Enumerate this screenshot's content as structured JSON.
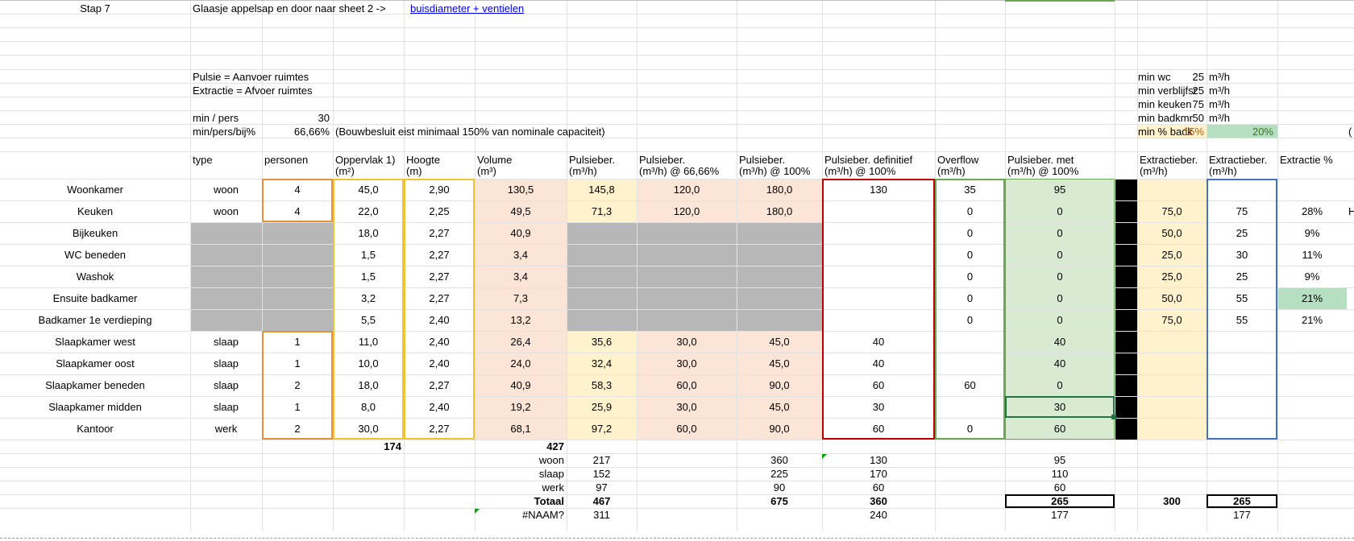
{
  "colors": {
    "grid": "#e2e2e2",
    "peach": "#fce4d6",
    "cream": "#fff2cc",
    "green": "#d9ead3",
    "gray": "#b7b7b7",
    "orange_border": "#f4b183",
    "orange_border_dark": "#e69138",
    "yellow_border": "#f1c232",
    "red_border": "#c00000",
    "green_border": "#6aa84f",
    "blue_border": "#4472c4",
    "selection": "#217346",
    "highlight_green": "#b6dfc1"
  },
  "top": {
    "step": "Stap 7",
    "instruction": "Glaasje appelsap en door naar sheet 2 ->",
    "link": "buisdiameter + ventielen",
    "pulsie_def": "Pulsie = Aanvoer ruimtes",
    "extractie_def": "Extractie = Afvoer ruimtes",
    "min_pers_label": "min / pers",
    "min_pers_value": "30",
    "bij_label": "min/pers/bij%",
    "bij_value": "66,66%",
    "bij_note": "(Bouwbesluit eist minimaal 150% van nominale capaciteit)"
  },
  "minimums": [
    {
      "label": "min wc",
      "value": "25",
      "unit": "m³/h"
    },
    {
      "label": "min verblijfsr",
      "value": "25",
      "unit": "m³/h"
    },
    {
      "label": "min keuken",
      "value": "75",
      "unit": "m³/h"
    },
    {
      "label": "min badkmr",
      "value": "50",
      "unit": "m³/h"
    },
    {
      "label": "min % badk",
      "value": "15%",
      "value2": "20%",
      "trailing": "("
    }
  ],
  "headers": [
    {
      "l1": "type",
      "l2": ""
    },
    {
      "l1": "personen",
      "l2": ""
    },
    {
      "l1": "Oppervlak 1)",
      "l2": "(m²)"
    },
    {
      "l1": "Hoogte",
      "l2": "(m)"
    },
    {
      "l1": "Volume",
      "l2": "(m³)"
    },
    {
      "l1": "Pulsieber.",
      "l2": "(m³/h)"
    },
    {
      "l1": "Pulsieber.",
      "l2": "(m³/h) @ 66,66%"
    },
    {
      "l1": "Pulsieber.",
      "l2": "(m³/h) @ 100%"
    },
    {
      "l1": "Pulsieber. definitief",
      "l2": "(m³/h) @ 100%"
    },
    {
      "l1": "Overflow",
      "l2": "(m³/h)"
    },
    {
      "l1": "Pulsieber. met",
      "l2": "(m³/h) @ 100%"
    },
    {
      "l1": "Extractieber.",
      "l2": "(m³/h)"
    },
    {
      "l1": "Extractieber.",
      "l2": "(m³/h)"
    },
    {
      "l1": "Extractie %",
      "l2": ""
    }
  ],
  "rows": [
    {
      "name": "Woonkamer",
      "type": "woon",
      "pers": "4",
      "opp": "45,0",
      "hoog": "2,90",
      "vol": "130,5",
      "p": "145,8",
      "p66": "120,0",
      "p100": "180,0",
      "pdef": "130",
      "over": "35",
      "pmet": "95",
      "ext": "",
      "ext2": "",
      "pct": ""
    },
    {
      "name": "Keuken",
      "type": "woon",
      "pers": "4",
      "opp": "22,0",
      "hoog": "2,25",
      "vol": "49,5",
      "p": "71,3",
      "p66": "120,0",
      "p100": "180,0",
      "pdef": "",
      "over": "0",
      "pmet": "0",
      "ext": "75,0",
      "ext2": "75",
      "pct": "28%",
      "trailing": "H"
    },
    {
      "name": "Bijkeuken",
      "type": "",
      "pers": "",
      "opp": "18,0",
      "hoog": "2,27",
      "vol": "40,9",
      "p": "",
      "p66": "",
      "p100": "",
      "pdef": "",
      "over": "0",
      "pmet": "0",
      "ext": "50,0",
      "ext2": "25",
      "pct": "9%"
    },
    {
      "name": "WC beneden",
      "type": "",
      "pers": "",
      "opp": "1,5",
      "hoog": "2,27",
      "vol": "3,4",
      "p": "",
      "p66": "",
      "p100": "",
      "pdef": "",
      "over": "0",
      "pmet": "0",
      "ext": "25,0",
      "ext2": "30",
      "pct": "11%"
    },
    {
      "name": "Washok",
      "type": "",
      "pers": "",
      "opp": "1,5",
      "hoog": "2,27",
      "vol": "3,4",
      "p": "",
      "p66": "",
      "p100": "",
      "pdef": "",
      "over": "0",
      "pmet": "0",
      "ext": "25,0",
      "ext2": "25",
      "pct": "9%"
    },
    {
      "name": "Ensuite badkamer",
      "type": "",
      "pers": "",
      "opp": "3,2",
      "hoog": "2,27",
      "vol": "7,3",
      "p": "",
      "p66": "",
      "p100": "",
      "pdef": "",
      "over": "0",
      "pmet": "0",
      "ext": "50,0",
      "ext2": "55",
      "pct": "21%"
    },
    {
      "name": "Badkamer 1e verdieping",
      "type": "",
      "pers": "",
      "opp": "5,5",
      "hoog": "2,40",
      "vol": "13,2",
      "p": "",
      "p66": "",
      "p100": "",
      "pdef": "",
      "over": "0",
      "pmet": "0",
      "ext": "75,0",
      "ext2": "55",
      "pct": "21%"
    },
    {
      "name": "Slaapkamer west",
      "type": "slaap",
      "pers": "1",
      "opp": "11,0",
      "hoog": "2,40",
      "vol": "26,4",
      "p": "35,6",
      "p66": "30,0",
      "p100": "45,0",
      "pdef": "40",
      "over": "",
      "pmet": "40",
      "ext": "",
      "ext2": "",
      "pct": ""
    },
    {
      "name": "Slaapkamer oost",
      "type": "slaap",
      "pers": "1",
      "opp": "10,0",
      "hoog": "2,40",
      "vol": "24,0",
      "p": "32,4",
      "p66": "30,0",
      "p100": "45,0",
      "pdef": "40",
      "over": "",
      "pmet": "40",
      "ext": "",
      "ext2": "",
      "pct": ""
    },
    {
      "name": "Slaapkamer beneden",
      "type": "slaap",
      "pers": "2",
      "opp": "18,0",
      "hoog": "2,27",
      "vol": "40,9",
      "p": "58,3",
      "p66": "60,0",
      "p100": "90,0",
      "pdef": "60",
      "over": "60",
      "pmet": "0",
      "ext": "",
      "ext2": "",
      "pct": ""
    },
    {
      "name": "Slaapkamer midden",
      "type": "slaap",
      "pers": "1",
      "opp": "8,0",
      "hoog": "2,40",
      "vol": "19,2",
      "p": "25,9",
      "p66": "30,0",
      "p100": "45,0",
      "pdef": "30",
      "over": "",
      "pmet": "30",
      "ext": "",
      "ext2": "",
      "pct": ""
    },
    {
      "name": "Kantoor",
      "type": "werk",
      "pers": "2",
      "opp": "30,0",
      "hoog": "2,27",
      "vol": "68,1",
      "p": "97,2",
      "p66": "60,0",
      "p100": "90,0",
      "pdef": "60",
      "over": "0",
      "pmet": "60",
      "ext": "",
      "ext2": "",
      "pct": ""
    }
  ],
  "totals": {
    "opp_sum": "174",
    "vol_sum": "427",
    "lines": [
      {
        "label": "woon",
        "p": "217",
        "p100": "360",
        "pdef": "130",
        "pmet": "95",
        "ext": "",
        "ext2": ""
      },
      {
        "label": "slaap",
        "p": "152",
        "p100": "225",
        "pdef": "170",
        "pmet": "110",
        "ext": "",
        "ext2": ""
      },
      {
        "label": "werk",
        "p": "97",
        "p100": "90",
        "pdef": "60",
        "pmet": "60",
        "ext": "",
        "ext2": ""
      },
      {
        "label": "Totaal",
        "p": "467",
        "p100": "675",
        "pdef": "360",
        "pmet": "265",
        "ext": "300",
        "ext2": "265"
      },
      {
        "label": "#NAAM?",
        "p": "311",
        "p100": "",
        "pdef": "240",
        "pmet": "177",
        "ext": "",
        "ext2": "177"
      }
    ]
  }
}
